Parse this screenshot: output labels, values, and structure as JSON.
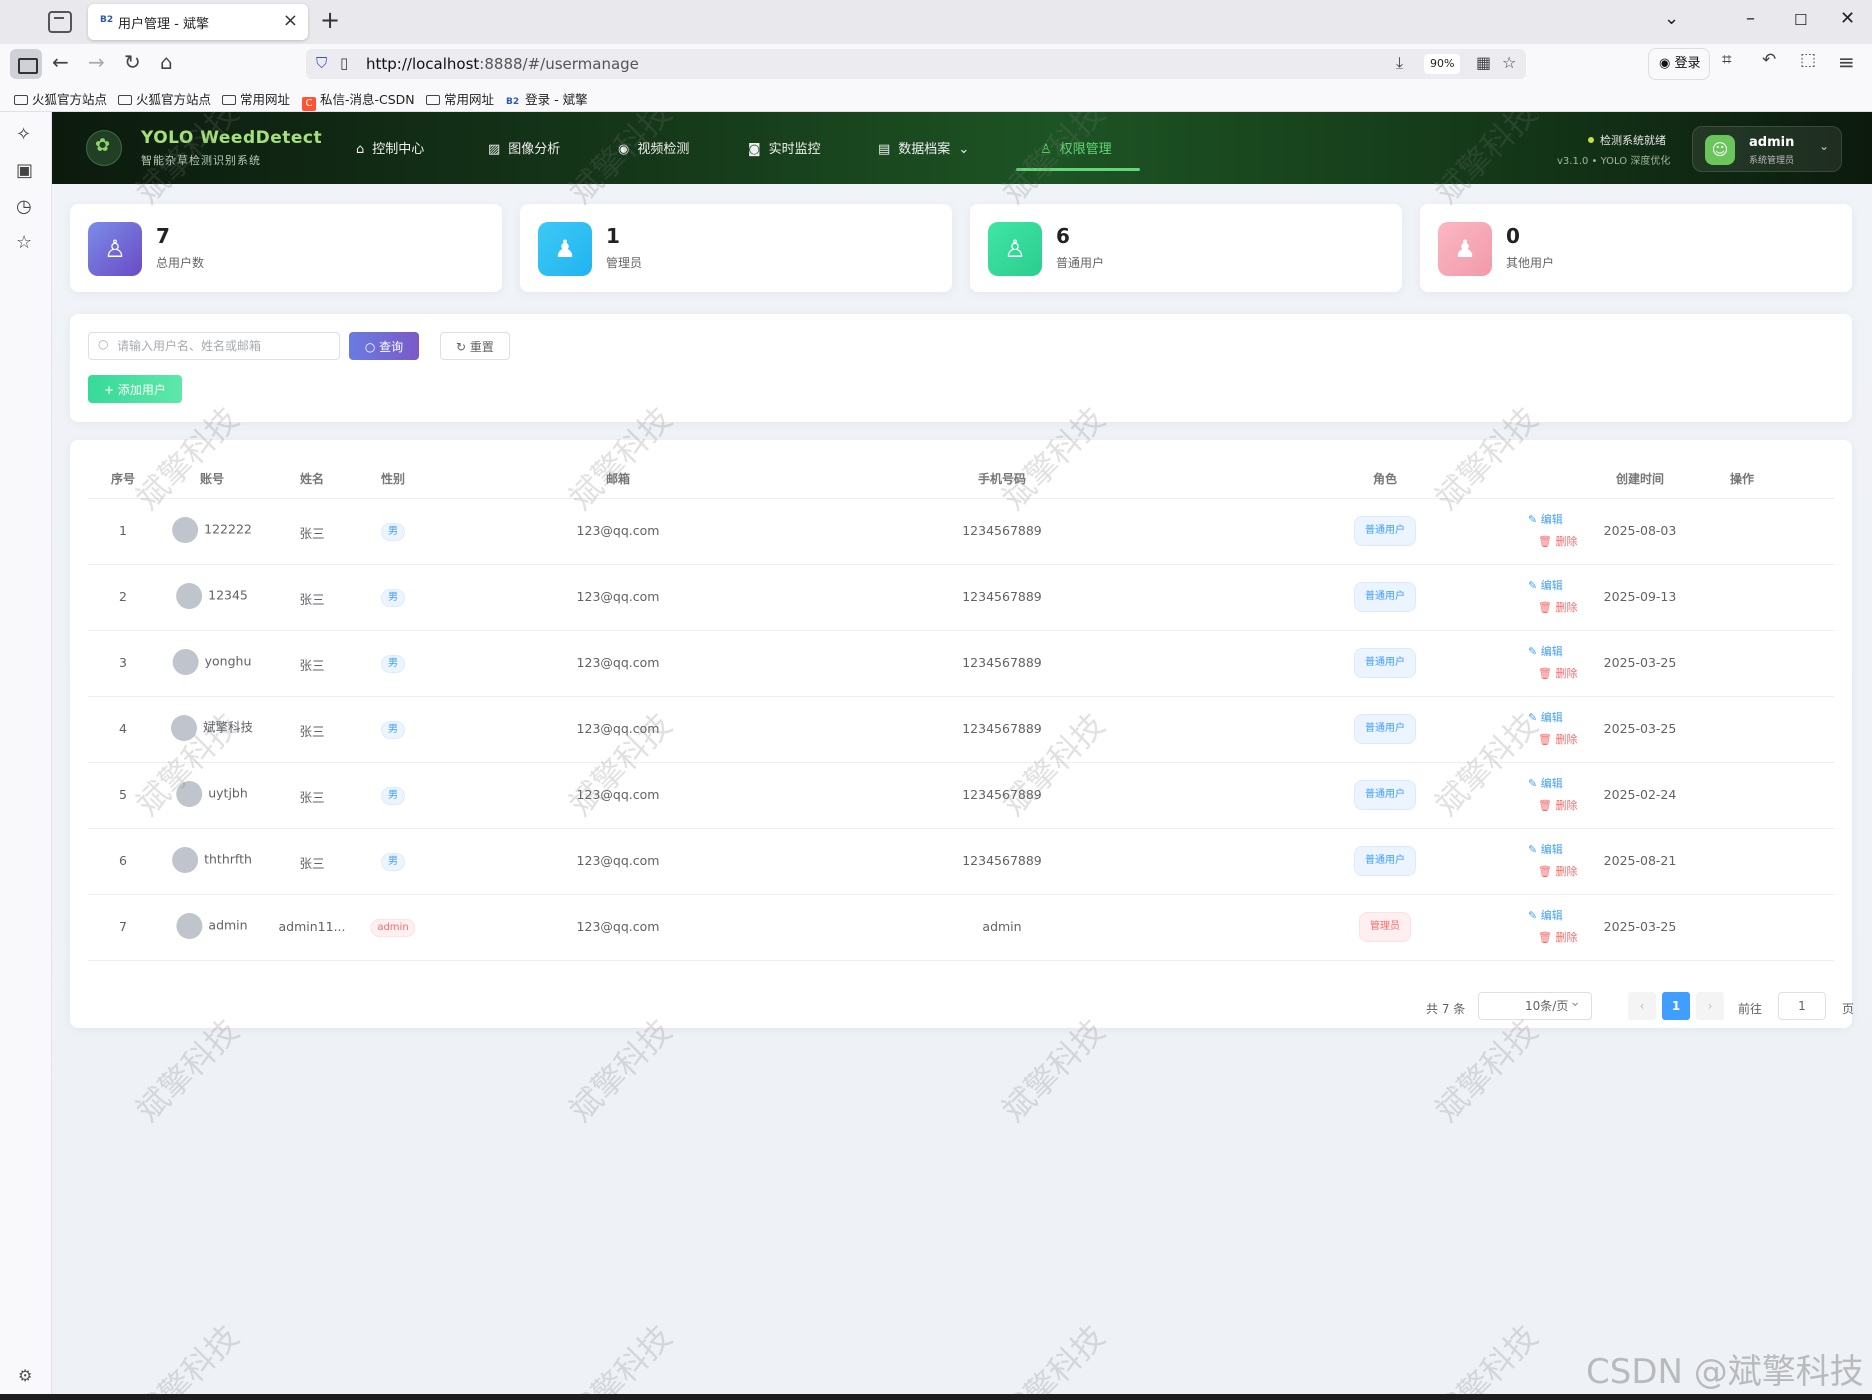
{
  "browser": {
    "tab_title": "用户管理 - 斌擎",
    "tab_favicon": "B2",
    "url_host": "http://localhost",
    "url_path": ":8888/#/usermanage",
    "zoom": "90%",
    "login_label": "登录"
  },
  "bookmarks": [
    {
      "label": "火狐官方站点",
      "icon": "folder-icon"
    },
    {
      "label": "火狐官方站点",
      "icon": "folder-icon"
    },
    {
      "label": "常用网址",
      "icon": "folder-icon"
    },
    {
      "label": "私信-消息-CSDN",
      "icon": "csdn-icon"
    },
    {
      "label": "常用网址",
      "icon": "folder-icon"
    },
    {
      "label": "登录 - 斌擎",
      "icon": "b2-icon"
    }
  ],
  "header": {
    "brand_title": "YOLO WeedDetect",
    "brand_subtitle": "智能杂草检测识别系统",
    "menu": [
      {
        "label": "控制中心",
        "icon": "home-icon"
      },
      {
        "label": "图像分析",
        "icon": "image-icon"
      },
      {
        "label": "视频检测",
        "icon": "play-icon"
      },
      {
        "label": "实时监控",
        "icon": "camera-icon"
      },
      {
        "label": "数据档案",
        "icon": "document-icon"
      },
      {
        "label": "权限管理",
        "icon": "user-icon"
      }
    ],
    "active_menu": "权限管理",
    "status": "检测系统就绪",
    "version": "v3.1.0 • YOLO 深度优化",
    "user_name": "admin",
    "user_role": "系统管理员"
  },
  "stats": [
    {
      "value": "7",
      "label": "总用户数",
      "color": "#6a5acd"
    },
    {
      "value": "1",
      "label": "管理员",
      "color": "#22c4f0"
    },
    {
      "value": "6",
      "label": "普通用户",
      "color": "#34d39a"
    },
    {
      "value": "0",
      "label": "其他用户",
      "color": "#f5a0b0"
    }
  ],
  "toolbar": {
    "search_placeholder": "请输入用户名、姓名或邮箱",
    "query_label": "查询",
    "reset_label": "重置",
    "add_label": "添加用户"
  },
  "table": {
    "columns": [
      "序号",
      "账号",
      "姓名",
      "性别",
      "邮箱",
      "手机号码",
      "角色",
      "创建时间",
      "操作"
    ],
    "rows": [
      {
        "index": "1",
        "account": "122222",
        "name": "张三",
        "gender": "男",
        "email": "123@qq.com",
        "phone": "1234567889",
        "role": "普通用户",
        "created": "2025-08-03"
      },
      {
        "index": "2",
        "account": "12345",
        "name": "张三",
        "gender": "男",
        "email": "123@qq.com",
        "phone": "1234567889",
        "role": "普通用户",
        "created": "2025-09-13"
      },
      {
        "index": "3",
        "account": "yonghu",
        "name": "张三",
        "gender": "男",
        "email": "123@qq.com",
        "phone": "1234567889",
        "role": "普通用户",
        "created": "2025-03-25"
      },
      {
        "index": "4",
        "account": "斌擎科技",
        "name": "张三",
        "gender": "男",
        "email": "123@qq.com",
        "phone": "1234567889",
        "role": "普通用户",
        "created": "2025-03-25"
      },
      {
        "index": "5",
        "account": "uytjbh",
        "name": "张三",
        "gender": "男",
        "email": "123@qq.com",
        "phone": "1234567889",
        "role": "普通用户",
        "created": "2025-02-24"
      },
      {
        "index": "6",
        "account": "ththrfth",
        "name": "张三",
        "gender": "男",
        "email": "123@qq.com",
        "phone": "1234567889",
        "role": "普通用户",
        "created": "2025-08-21"
      },
      {
        "index": "7",
        "account": "admin",
        "name": "admin11...",
        "gender": "admin",
        "email": "123@qq.com",
        "phone": "admin",
        "role": "管理员",
        "created": "2025-03-25"
      }
    ],
    "edit_label": "编辑",
    "delete_label": "删除"
  },
  "pagination": {
    "total_label": "共 7 条",
    "page_size": "10条/页",
    "current_page": "1",
    "goto_label": "前往",
    "goto_value": "1",
    "page_suffix": "页"
  },
  "watermark": "斌擎科技",
  "csdn_watermark": "CSDN @斌擎科技"
}
